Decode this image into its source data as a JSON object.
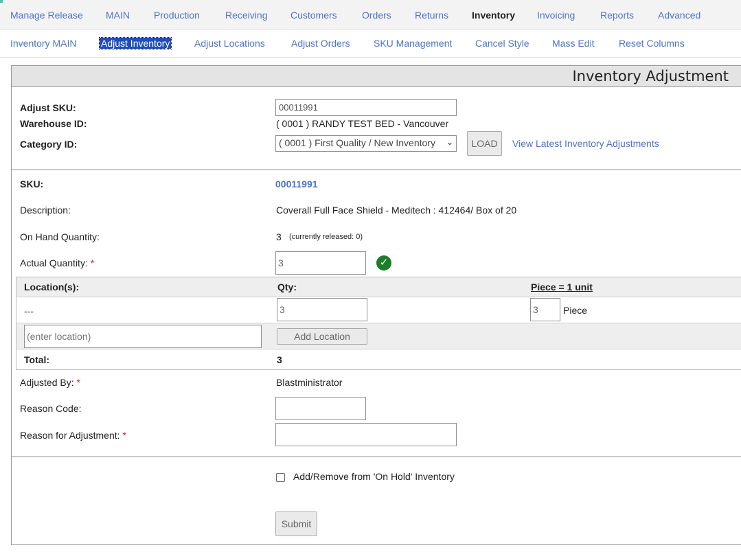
{
  "top_nav": [
    {
      "label": "Manage Release",
      "active": false
    },
    {
      "label": "MAIN",
      "active": false
    },
    {
      "label": "Production",
      "active": false
    },
    {
      "label": "Receiving",
      "active": false
    },
    {
      "label": "Customers",
      "active": false
    },
    {
      "label": "Orders",
      "active": false
    },
    {
      "label": "Returns",
      "active": false
    },
    {
      "label": "Inventory",
      "active": true
    },
    {
      "label": "Invoicing",
      "active": false
    },
    {
      "label": "Reports",
      "active": false
    },
    {
      "label": "Advanced",
      "active": false
    }
  ],
  "sub_nav": [
    {
      "label": "Inventory MAIN",
      "active": false
    },
    {
      "label": "Adjust Inventory",
      "active": true
    },
    {
      "label": "Adjust Locations",
      "active": false
    },
    {
      "label": "Adjust Orders",
      "active": false
    },
    {
      "label": "SKU Management",
      "active": false
    },
    {
      "label": "Cancel Style",
      "active": false
    },
    {
      "label": "Mass Edit",
      "active": false
    },
    {
      "label": "Reset Columns",
      "active": false
    }
  ],
  "panel": {
    "title": "Inventory Adjustment",
    "adjust_sku_label": "Adjust SKU:",
    "adjust_sku_value": "00011991",
    "warehouse_label": "Warehouse ID:",
    "warehouse_value": "( 0001 ) RANDY TEST BED - Vancouver",
    "category_label": "Category ID:",
    "category_value": "( 0001 ) First Quality / New Inventory",
    "load_label": "LOAD",
    "view_latest_link": "View Latest Inventory Adjustments"
  },
  "details": {
    "sku_label": "SKU:",
    "sku_value": "00011991",
    "description_label": "Description:",
    "description_value": "Coverall Full Face Shield - Meditech : 412464/ Box of 20",
    "on_hand_label": "On Hand Quantity:",
    "on_hand_value": "3",
    "on_hand_note": "(currently released: 0)",
    "actual_qty_label": "Actual Quantity:",
    "required_mark": "*",
    "actual_qty_value": "3"
  },
  "locations": {
    "header_location": "Location(s):",
    "header_qty": "Qty:",
    "header_piece": "Piece = 1 unit",
    "row_location": "---",
    "row_qty": "3",
    "row_piece_qty": "3",
    "row_piece_unit": "Piece",
    "new_location_placeholder": "(enter location)",
    "add_location_label": "Add Location",
    "total_label": "Total:",
    "total_value": "3"
  },
  "adjustment": {
    "adjusted_by_label": "Adjusted By:",
    "adjusted_by_value": "Blastministrator",
    "reason_code_label": "Reason Code:",
    "reason_code_value": "",
    "reason_label": "Reason for Adjustment:",
    "reason_value": "",
    "on_hold_label": "Add/Remove from 'On Hold' Inventory",
    "on_hold_checked": false,
    "submit_label": "Submit"
  },
  "colors": {
    "link": "#4d74c9",
    "active_tab_bg": "#1f4fb8",
    "required": "#d21d1d",
    "success": "#1c7e28"
  }
}
